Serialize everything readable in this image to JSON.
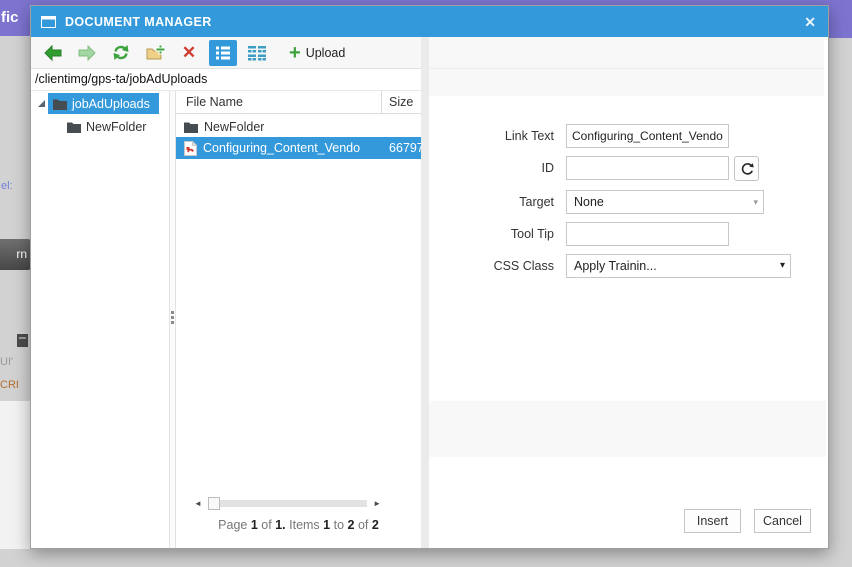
{
  "background": {
    "top_left_text": "fic",
    "left_link_text": "el:",
    "left_button_text": "rn",
    "left_text_1": "UI'",
    "left_text_2": "CRI"
  },
  "dialog": {
    "title": "DOCUMENT MANAGER",
    "close_glyph": "✕",
    "toolbar": {
      "delete_glyph": "✕",
      "upload_plus_glyph": "+",
      "upload_label": "Upload"
    },
    "path": "/clientimg/gps-ta/jobAdUploads",
    "tree": {
      "items": [
        {
          "label": "jobAdUploads",
          "selected": true
        },
        {
          "label": "NewFolder",
          "selected": false
        }
      ]
    },
    "file_list": {
      "columns": [
        "File Name",
        "Size"
      ],
      "rows": [
        {
          "name": "NewFolder",
          "size": "",
          "type": "folder",
          "selected": false
        },
        {
          "name": "Configuring_Content_Vendo",
          "size": "66797",
          "type": "pdf",
          "selected": true
        }
      ]
    },
    "scrollbar": {
      "left_glyph": "◄",
      "right_glyph": "►"
    },
    "pager": {
      "parts": [
        "Page",
        "1",
        "of",
        "1.",
        "Items",
        "1",
        "to",
        "2",
        "of",
        "2"
      ]
    },
    "form": {
      "fields": [
        {
          "label": "Link Text",
          "value": "Configuring_Content_Vendor"
        },
        {
          "label": "ID",
          "value": ""
        },
        {
          "label": "Target",
          "value": "None"
        },
        {
          "label": "Tool Tip",
          "value": ""
        },
        {
          "label": "CSS Class",
          "value": "Apply Trainin..."
        }
      ]
    },
    "footer": {
      "insert_label": "Insert",
      "cancel_label": "Cancel"
    }
  },
  "colors": {
    "accent_blue": "#3399db",
    "purple": "#7d74d0",
    "green": "#3da23d",
    "red": "#cf3a30",
    "outer_gray": "#d2d2d2"
  }
}
